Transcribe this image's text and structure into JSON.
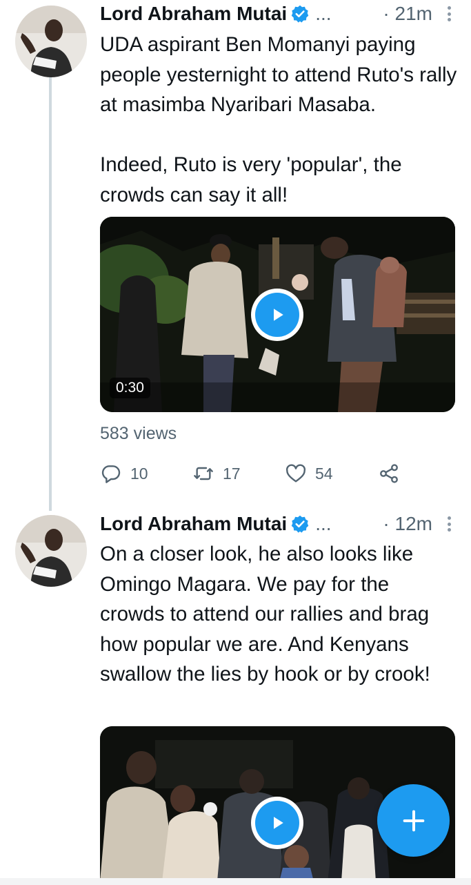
{
  "tweets": [
    {
      "author": "Lord Abraham Mutai",
      "ellipsis": "...",
      "time": "· 21m",
      "text": "UDA aspirant Ben Momanyi paying people yesternight to attend Ruto's rally at masimba Nyaribari Masaba.\n\nIndeed, Ruto is very 'popular', the crowds can say it all!",
      "video_duration": "0:30",
      "views": "583 views",
      "replies": "10",
      "retweets": "17",
      "likes": "54"
    },
    {
      "author": "Lord Abraham Mutai",
      "ellipsis": "...",
      "time": "· 12m",
      "text": "On a closer look, he also looks like Omingo Magara. We pay for the crowds to attend our rallies and brag how popular we are. And Kenyans swallow the lies by hook or by crook!"
    }
  ],
  "icons": {
    "verified": "verified-badge-icon",
    "reply": "reply-icon",
    "retweet": "retweet-icon",
    "like": "heart-icon",
    "share": "share-icon",
    "more": "more-vertical-icon",
    "play": "play-icon",
    "compose": "plus-icon"
  },
  "colors": {
    "accent": "#1d9bf0",
    "text": "#0f1419",
    "secondary": "#536471"
  }
}
